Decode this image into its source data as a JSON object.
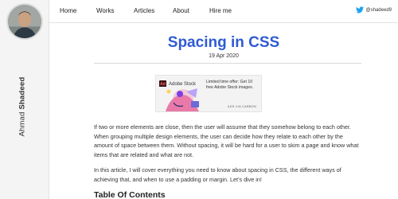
{
  "sidebar": {
    "author_first": "Ahmad",
    "author_last": "Shadeed"
  },
  "nav": {
    "items": [
      {
        "label": "Home"
      },
      {
        "label": "Works"
      },
      {
        "label": "Articles"
      },
      {
        "label": "About"
      },
      {
        "label": "Hire me"
      }
    ],
    "twitter_handle": "@shadeed9"
  },
  "post": {
    "title": "Spacing in CSS",
    "date": "19 Apr 2020"
  },
  "ad": {
    "logo_text": "Ad",
    "brand": "Adobe Stock",
    "text": "Limited time offer: Get 10 free Adobe Stock images.",
    "via": "ADS VIA CARBON"
  },
  "article": {
    "paragraphs": [
      "If two or more elements are close, then the user will assume that they somehow belong to each other. When grouping multiple design elements, the user can decide how they relate to each other by the amount of space between them. Without spacing, it will be hard for a user to skim a page and know what items that are related and what are not.",
      "In this article, I will cover everything you need to know about spacing in CSS, the different ways of achieving that, and when to use a padding or margin. Let’s dive in!"
    ],
    "toc_heading": "Table Of Contents"
  },
  "colors": {
    "title": "#2f5bd3",
    "twitter": "#1da1f2",
    "sidebar_bg": "#f4f4f4"
  }
}
